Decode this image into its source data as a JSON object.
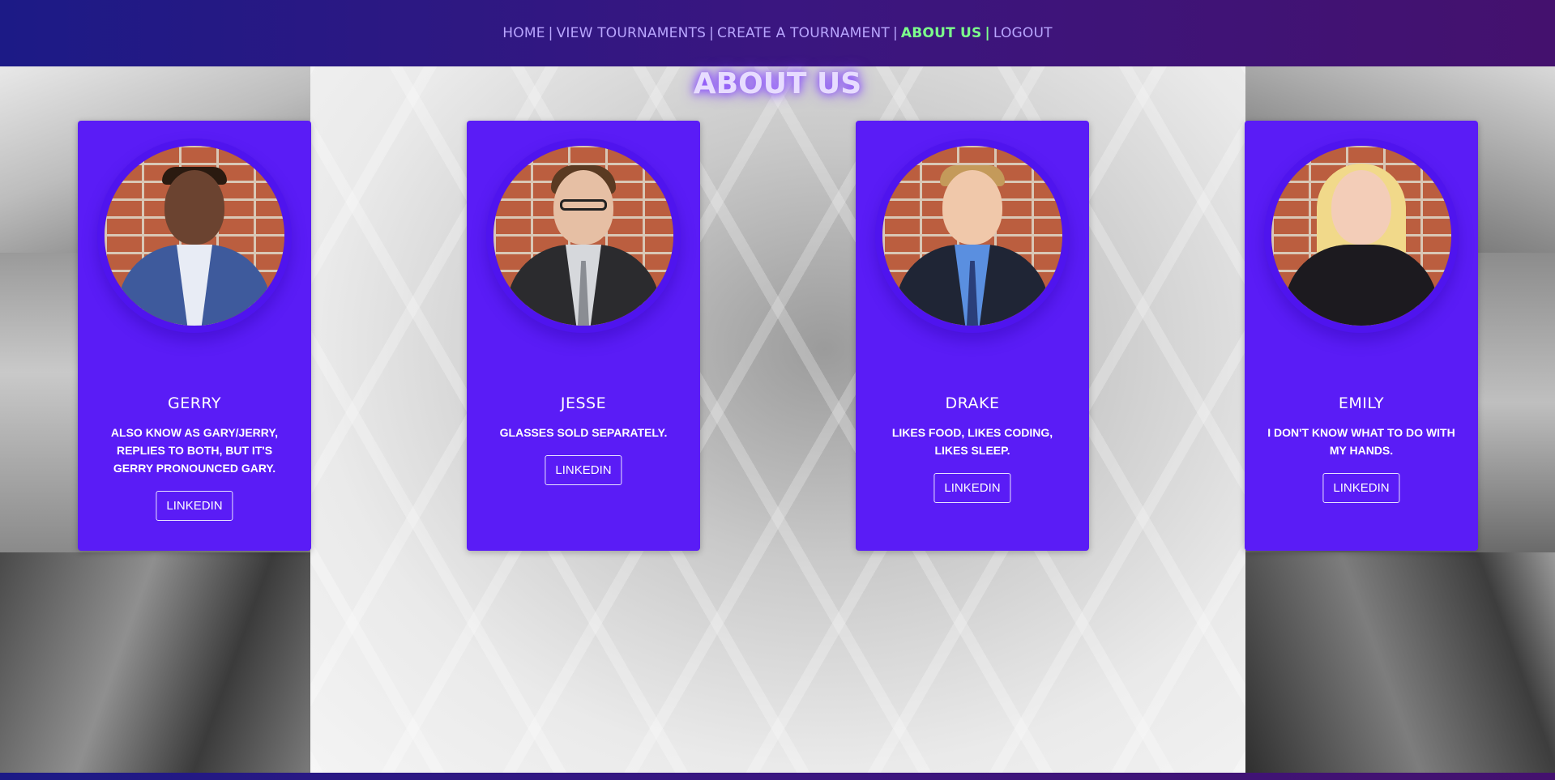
{
  "nav": {
    "home": "HOME",
    "view_tournaments": "VIEW TOURNAMENTS",
    "create_tournament": "CREATE A TOURNAMENT",
    "about_us": "ABOUT US",
    "logout": "LOGOUT",
    "separator": "|"
  },
  "page": {
    "title": "ABOUT US"
  },
  "team": [
    {
      "name": "GERRY",
      "description": "ALSO KNOW AS GARY/JERRY, REPLIES TO BOTH, BUT IT'S GERRY PRONOUNCED GARY.",
      "link_label": "LINKEDIN"
    },
    {
      "name": "JESSE",
      "description": "GLASSES SOLD SEPARATELY.",
      "link_label": "LINKEDIN"
    },
    {
      "name": "DRAKE",
      "description": "LIKES FOOD, LIKES CODING, LIKES SLEEP.",
      "link_label": "LINKEDIN"
    },
    {
      "name": "EMILY",
      "description": "I DON'T KNOW WHAT TO DO WITH MY HANDS.",
      "link_label": "LINKEDIN"
    }
  ],
  "colors": {
    "card": "#5a1cf6",
    "nav_link": "#b9a6ff",
    "nav_active": "#7cff8b",
    "title_glow": "#8b4dff"
  }
}
